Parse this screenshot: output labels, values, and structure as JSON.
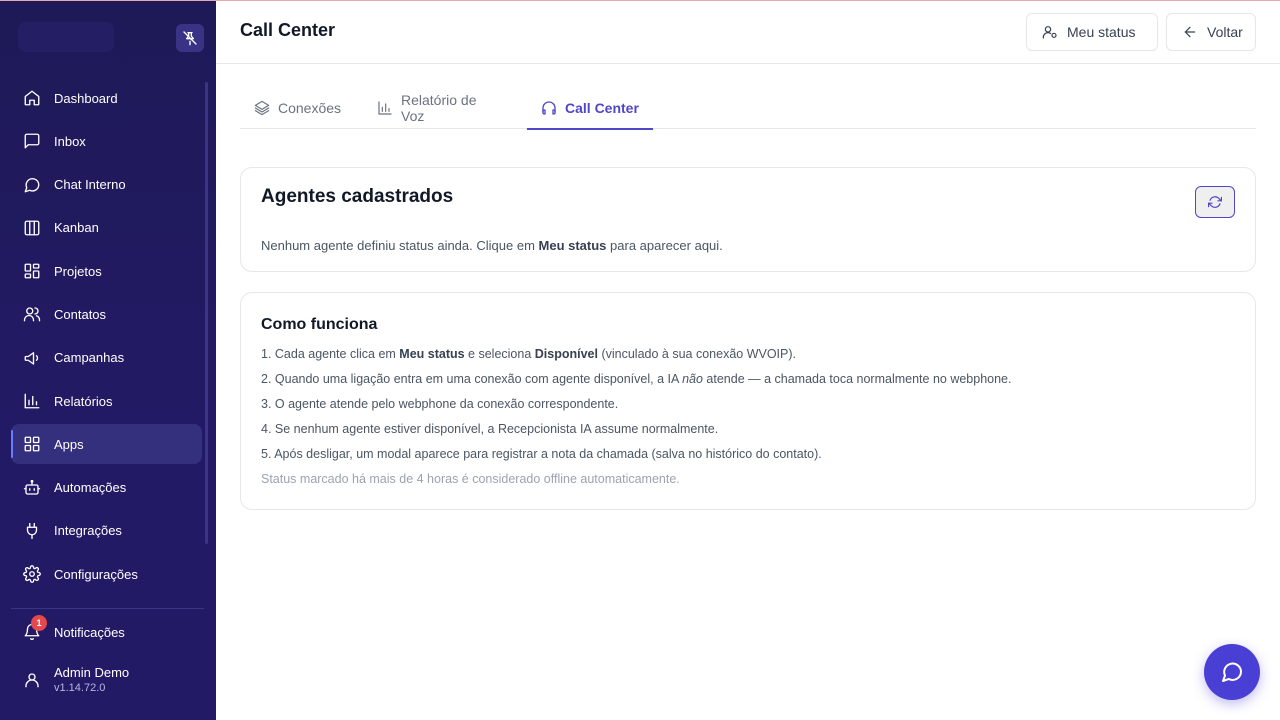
{
  "header": {
    "title": "Call Center",
    "status_button": "Meu status",
    "back_button": "Voltar"
  },
  "sidebar": {
    "items": [
      {
        "label": "Dashboard",
        "icon": "home-icon"
      },
      {
        "label": "Inbox",
        "icon": "message-square-icon"
      },
      {
        "label": "Chat Interno",
        "icon": "message-circle-icon"
      },
      {
        "label": "Kanban",
        "icon": "columns-icon"
      },
      {
        "label": "Projetos",
        "icon": "layout-grid-icon"
      },
      {
        "label": "Contatos",
        "icon": "users-icon"
      },
      {
        "label": "Campanhas",
        "icon": "megaphone-icon"
      },
      {
        "label": "Relatórios",
        "icon": "bar-chart-icon"
      },
      {
        "label": "Apps",
        "icon": "apps-grid-icon",
        "active": true
      },
      {
        "label": "Automações",
        "icon": "bot-icon"
      },
      {
        "label": "Integrações",
        "icon": "plug-icon"
      },
      {
        "label": "Configurações",
        "icon": "settings-icon"
      }
    ],
    "notifications": {
      "label": "Notificações",
      "count": "1"
    },
    "user": {
      "name": "Admin Demo",
      "version": "v1.14.72.0"
    }
  },
  "tabs": [
    {
      "label": "Conexões",
      "icon": "layers-icon"
    },
    {
      "label": "Relatório de Voz",
      "icon": "bar-chart-icon"
    },
    {
      "label": "Call Center",
      "icon": "headphones-icon",
      "active": true
    }
  ],
  "agents_card": {
    "title": "Agentes cadastrados",
    "empty_before": "Nenhum agente definiu status ainda. Clique em ",
    "empty_bold": "Meu status",
    "empty_after": " para aparecer aqui."
  },
  "how_card": {
    "title": "Como funciona",
    "step1_a": "1. Cada agente clica em ",
    "step1_b": "Meu status",
    "step1_c": " e seleciona ",
    "step1_d": "Disponível",
    "step1_e": " (vinculado à sua conexão WVOIP).",
    "step2_a": "2. Quando uma ligação entra em uma conexão com agente disponível, a IA ",
    "step2_b": "não",
    "step2_c": " atende — a chamada toca normalmente no webphone.",
    "step3": "3. O agente atende pelo webphone da conexão correspondente.",
    "step4": "4. Se nenhum agente estiver disponível, a Recepcionista IA assume normalmente.",
    "step5": "5. Após desligar, um modal aparece para registrar a nota da chamada (salva no histórico do contato).",
    "note": "Status marcado há mais de 4 horas é considerado offline automaticamente."
  },
  "colors": {
    "sidebar_bg": "#211a62",
    "accent": "#4f46c8",
    "fab": "#4a3fd4",
    "badge": "#e5484d"
  }
}
